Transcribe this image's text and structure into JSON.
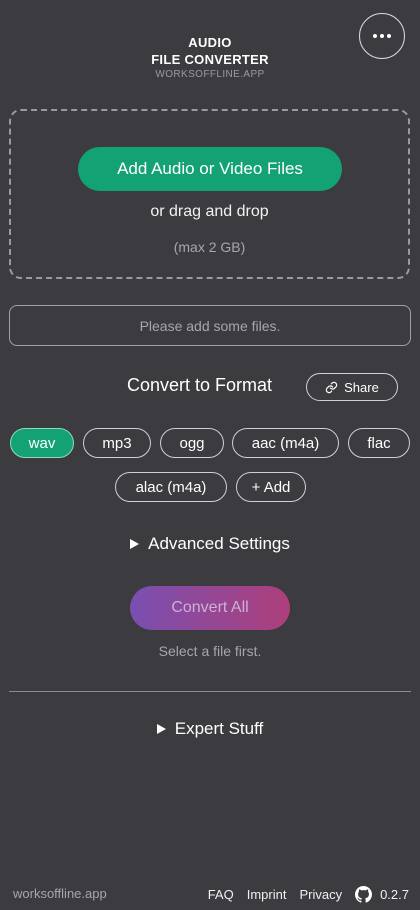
{
  "header": {
    "title_line1": "AUDIO",
    "title_line2": "FILE CONVERTER",
    "subtitle": "WORKSOFFLINE.APP",
    "menu_icon": "more-dots-icon"
  },
  "dropzone": {
    "add_button_label": "Add Audio or Video Files",
    "drag_text": "or drag and drop",
    "max_text": "(max 2 GB)"
  },
  "status": {
    "message": "Please add some files."
  },
  "format": {
    "heading": "Convert to Format",
    "share_label": "Share",
    "share_icon": "link-icon",
    "options": [
      "wav",
      "mp3",
      "ogg",
      "aac (m4a)",
      "flac",
      "alac (m4a)",
      "+ Add"
    ],
    "selected": "wav"
  },
  "advanced": {
    "label": "Advanced Settings"
  },
  "convert": {
    "button_label": "Convert All",
    "hint": "Select a file first."
  },
  "expert": {
    "label": "Expert Stuff"
  },
  "footer": {
    "brand": "worksoffline.app",
    "faq": "FAQ",
    "imprint": "Imprint",
    "privacy": "Privacy",
    "github_icon": "github-icon",
    "version": "0.2.7"
  },
  "colors": {
    "background": "#3b3b40",
    "accent_green": "#13a274",
    "convert_gradient_start": "#7a4fb0",
    "convert_gradient_end": "#ae3f7a"
  }
}
